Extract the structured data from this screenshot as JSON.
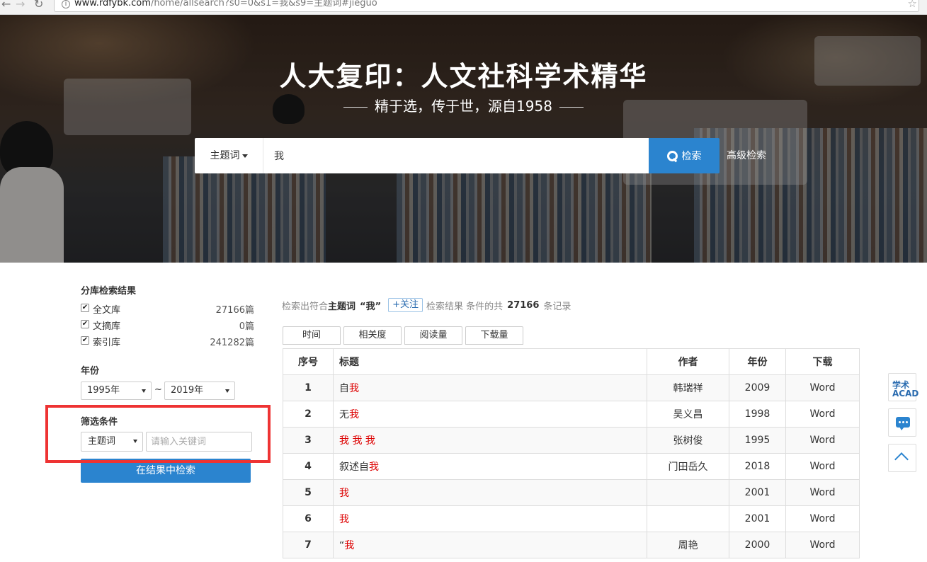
{
  "browser": {
    "url_host": "www.rdfybk.com",
    "url_path": "/home/allsearch?s0=0&s1=我&s9=主题词#jieguo"
  },
  "hero": {
    "title": "人大复印：人文社科学术精华",
    "subtitle": "精于选，传于世，源自1958",
    "search_scope": "主题词",
    "search_value": "我",
    "search_button": "检索",
    "advanced_link": "高级检索"
  },
  "sidebar": {
    "libraries_heading": "分库检索结果",
    "libraries": [
      {
        "name": "全文库",
        "count": "27166篇",
        "checked": true
      },
      {
        "name": "文摘库",
        "count": "0篇",
        "checked": true
      },
      {
        "name": "索引库",
        "count": "241282篇",
        "checked": true
      }
    ],
    "year_heading": "年份",
    "year_from": "1995年",
    "year_to": "2019年",
    "tilde": "~",
    "filter_heading": "筛选条件",
    "filter_field": "主题词",
    "filter_placeholder": "请输入关键词",
    "refine_button": "在结果中检索"
  },
  "summary": {
    "prefix": "检索出符合",
    "field": "主题词",
    "term": "“我”",
    "follow": "+关注",
    "middle": "检索结果 条件的共",
    "count": "27166",
    "suffix": "条记录"
  },
  "sort_tabs": [
    "时间",
    "相关度",
    "阅读量",
    "下载量"
  ],
  "table": {
    "headers": [
      "序号",
      "标题",
      "作者",
      "年份",
      "下载"
    ],
    "rows": [
      {
        "no": "1",
        "pre": "自",
        "hl": "我",
        "post": "",
        "author": "韩瑞祥",
        "year": "2009",
        "dl": "Word"
      },
      {
        "no": "2",
        "pre": "无",
        "hl": "我",
        "post": "",
        "author": "吴义昌",
        "year": "1998",
        "dl": "Word"
      },
      {
        "no": "3",
        "pre": "",
        "hl": "我 我 我",
        "post": "",
        "author": "张树俊",
        "year": "1995",
        "dl": "Word"
      },
      {
        "no": "4",
        "pre": "叙述自",
        "hl": "我",
        "post": "",
        "author": "门田岳久",
        "year": "2018",
        "dl": "Word"
      },
      {
        "no": "5",
        "pre": "",
        "hl": "我",
        "post": "",
        "author": "",
        "year": "2001",
        "dl": "Word"
      },
      {
        "no": "6",
        "pre": "",
        "hl": "我",
        "post": "",
        "author": "",
        "year": "2001",
        "dl": "Word"
      },
      {
        "no": "7",
        "pre": "“",
        "hl": "我",
        "post": "",
        "author": "周艳",
        "year": "2000",
        "dl": "Word"
      }
    ]
  },
  "float": {
    "acad_label": "学术\nACAD"
  },
  "colors": {
    "accent": "#2b84cf",
    "highlight": "#dd0000",
    "annotation_box": "#ee3333"
  }
}
